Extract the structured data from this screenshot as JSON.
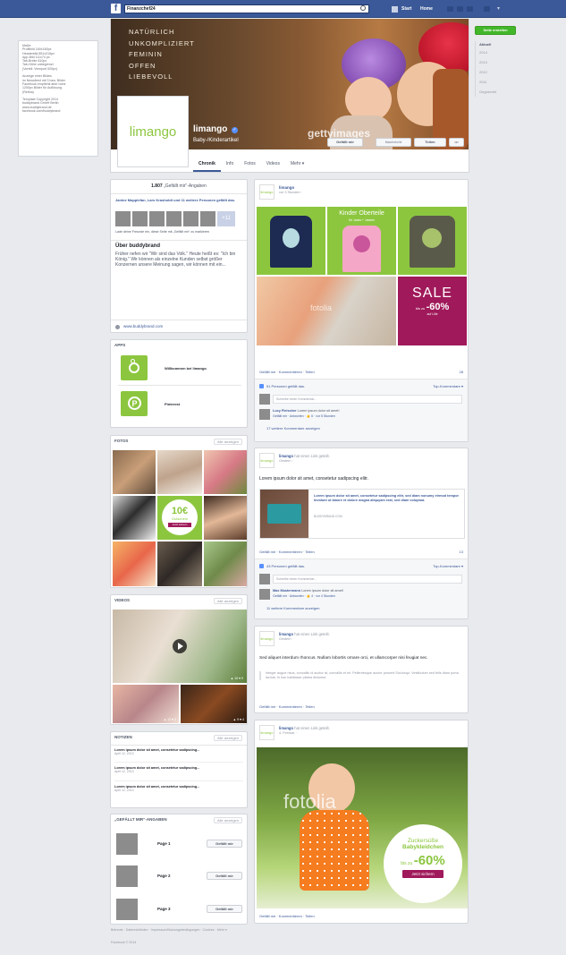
{
  "topbar": {
    "logo": "f",
    "search_value": "Finanzchef24",
    "nav_home": "Start",
    "nav_startseite": "Home",
    "settings_label": "▾"
  },
  "left_info": {
    "lines": [
      "Maße:",
      "Profilbild 160x160px",
      "Headerbild 851x315px",
      "App-Bild 111x74 px",
      "Tab-Breite 810px",
      "Tab-Höhe unbegrenzt",
      "  (Vorteil: Viewport 520px)",
      "",
      "Anzeige einer Bildes",
      "im Newsfeed mit 3 bzw. Bilder",
      "Facebook empfiehlt aber hohe",
      "1200px Bilder für Auflösung",
      "(Retina)",
      "",
      "Template Copyright 2014",
      "buddybrand GmbH Berlin",
      "www.buddybrand.de",
      "facebook.com/buddybrand"
    ]
  },
  "right_col": {
    "create_page": "Seite erstellen",
    "years": [
      "Aktuell",
      "2014",
      "2013",
      "2012",
      "2011",
      "Gegründet"
    ]
  },
  "cover": {
    "slogan": [
      "NATÜRLICH",
      "UNKOMPLIZIERT",
      "FEMININ",
      "OFFEN",
      "LIEBEVOLL"
    ],
    "watermark": "gettyimages",
    "page_name": "limango",
    "category": "Baby-/Kinderartikel",
    "like_btn": "Gefällt mir",
    "msg_btn": "Nachricht",
    "share_btn": "Teilen",
    "more_btn": "•••",
    "logo_text": "limango"
  },
  "tabs": [
    "Chronik",
    "Info",
    "Fotos",
    "Videos",
    "Mehr ▾"
  ],
  "about": {
    "likes": "1.807",
    "likes_label": "„Gefällt mir“-Angaben",
    "friends_text": "Janine Mapplefan, Lars Krasholdt und 11 weitere Personen gefällt das.",
    "plus": "+11",
    "invite": "Lade deine Freunde ein, diese Seite mit „Gefällt mir“ zu markieren",
    "about_title": "Über buddybrand",
    "about_text": "Früher nefen wir \"Wir sind das Volk.\" Heute heißt es: \"Ich bin König.\" Wir können als einzelne Kunden selbst größer Konzernen unsere Meinung sagen, wir können mit ein...",
    "website": "www.buddybrand.com"
  },
  "apps": {
    "title": "APPS",
    "items": [
      {
        "label": "Willkommen bei limango"
      },
      {
        "label": "Pinterest"
      }
    ]
  },
  "photos": {
    "title": "FOTOS",
    "show_all": "Alle anzeigen",
    "promo_price": "10€",
    "promo_line1": "Gutschein",
    "promo_btn": "Jetzt sichern"
  },
  "videos": {
    "title": "VIDEOS",
    "show_all": "Alle anzeigen",
    "stats": "▲ 15 ♥ 9",
    "stats2": "▲ 12 ♥ 3",
    "stats3": "▲ 9 ♥ 4"
  },
  "notes": {
    "title": "NOTIZEN",
    "show_all": "Alle anzeigen",
    "items": [
      {
        "title": "Lorem ipsum dolor sit amet, consetetur sadipscing...",
        "date": "April 12, 2013"
      },
      {
        "title": "Lorem ipsum dolor sit amet, consetetur sadipscing...",
        "date": "April 12, 2013"
      },
      {
        "title": "Lorem ipsum dolor sit amet, consetetur sadipscing...",
        "date": "April 12, 2013"
      }
    ]
  },
  "likes_box": {
    "title": "„GEFÄLLT MIR“-ANGABEN",
    "show_all": "Alle anzeigen",
    "pages": [
      "Page 1",
      "Page 2",
      "Page 3"
    ],
    "btn": "Gefällt mir"
  },
  "footer": {
    "text": "Betreute · Datenrichtlinien · Impressum/Nutzungsbedingungen · Cookies · Mehr ▾",
    "copyright": "Facebook © 2014"
  },
  "post1": {
    "author": "limango",
    "time": "vor 3 Stunden ·",
    "tile_title": "Kinder Oberteile",
    "tile_sub": "für Jacks + Jacken",
    "sale": "SALE",
    "sale_sub": "bis zu",
    "sale_pct": "-60%",
    "sale_small": "auf Lille",
    "actions": "Gefällt mir · Kommentieren · Teilen",
    "shares": "28",
    "likes_line": "51 Personen gefällt das.",
    "top_comments": "Top-Kommentare ▾",
    "comment_placeholder": "Schreibe einen Kommentar...",
    "comment_author": "Lucy Fleischer",
    "comment_text": "Lorem ipsum dolor sit amet!",
    "comment_meta": "Gefällt mir · Antworten · 👍 6 · vor 5 Stunden",
    "more_comments": "17 weitere Kommentare anzeigen"
  },
  "post2": {
    "author": "limango",
    "shared": "hat einen Link geteilt.",
    "time": "Gestern ·",
    "text": "Lorem ipsum dolor sit amet, consetetur sadipscing elitr.",
    "link_title": "Lorem ipsum dolor sit amet, consetetur sadipscing elitr, sed diam nonumy eirmod tempor invidunt ut labore et dolore magna aliquyam erat, sed diam voluptua.",
    "link_domain": "BUDDYBRAND.COM",
    "actions": "Gefällt mir · Kommentieren · Teilen",
    "shares": "13",
    "likes_line": "43 Personen gefällt das.",
    "top_comments": "Top-Kommentare ▾",
    "comment_placeholder": "Schreibe einen Kommentar...",
    "comment_author": "Max Mustermann",
    "comment_text": "Lorem ipsum dolor sit amet!",
    "comment_meta": "Gefällt mir · Antworten · 👍 4 · vor 4 Stunden",
    "more_comments": "11 weitere Kommentare anzeigen"
  },
  "post3": {
    "author": "limango",
    "shared": "hat einen Link geteilt.",
    "time": "Gestern ·",
    "text": "Sed aliquet interdum rhoncus. Nullam lobortis ornare orci, et ullamcorper nisi feugiat nec.",
    "quote": "Integer augue risus, convallis id auctor at, convallis et mi. Pellentesque auctor prosent Sociosqu. Vestibulum sed felis diam porta lacinia. In hac habitasse platea dictumst.",
    "actions": "Gefällt mir · Kommentieren · Teilen"
  },
  "post4": {
    "author": "limango",
    "shared": "hat einen Link geteilt.",
    "time": "4. Februar ·",
    "watermark": "fotolia",
    "promo_line1": "Zuckersüße",
    "promo_line2": "Babykleidchen",
    "promo_pre": "bis zu",
    "promo_pct": "-60%",
    "promo_btn": "Jetzt sichern",
    "actions": "Gefällt mir · Kommentieren · Teilen"
  }
}
